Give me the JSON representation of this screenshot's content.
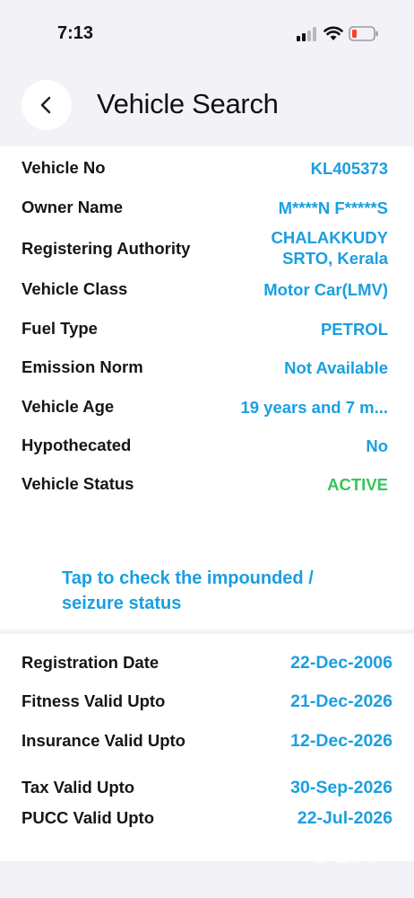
{
  "status_bar": {
    "time": "7:13"
  },
  "header": {
    "title": "Vehicle Search"
  },
  "details": [
    {
      "label": "Vehicle No",
      "value": "KL405373"
    },
    {
      "label": "Owner Name",
      "value": "M****N F*****S"
    },
    {
      "label": "Registering Authority",
      "value": "CHALAKKUDY SRTO, Kerala"
    },
    {
      "label": "Vehicle Class",
      "value": "Motor Car(LMV)"
    },
    {
      "label": "Fuel Type",
      "value": "PETROL"
    },
    {
      "label": "Emission Norm",
      "value": "Not Available"
    },
    {
      "label": "Vehicle Age",
      "value": "19 years and 7 m..."
    },
    {
      "label": "Hypothecated",
      "value": "No"
    },
    {
      "label": "Vehicle Status",
      "value": "ACTIVE"
    }
  ],
  "impound_link": "Tap to check the impounded / seizure status",
  "validity": [
    {
      "label": "Registration Date",
      "value": "22-Dec-2006"
    },
    {
      "label": "Fitness Valid Upto",
      "value": "21-Dec-2026"
    },
    {
      "label": "Insurance Valid Upto",
      "value": "12-Dec-2026"
    },
    {
      "label": "Tax Valid Upto",
      "value": "30-Sep-2026"
    },
    {
      "label": "PUCC Valid Upto",
      "value": "22-Jul-2026"
    }
  ],
  "colors": {
    "accent": "#1a9fe0",
    "active": "#34c759",
    "background": "#f2f2f7"
  },
  "icons": [
    "signal-icon",
    "wifi-icon",
    "battery-icon",
    "chevron-left-icon",
    "olx-logo"
  ]
}
